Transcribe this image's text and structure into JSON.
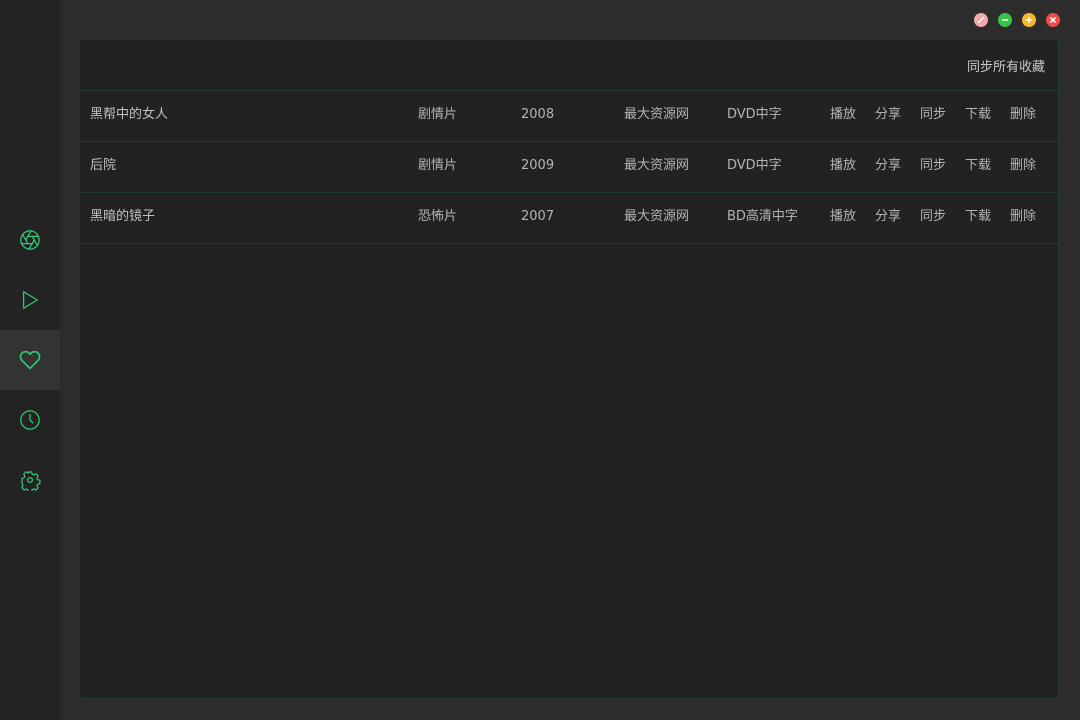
{
  "colors": {
    "accent": "#2ecc71",
    "window_reset": "#f4a7a7",
    "window_minimize": "#39c24a",
    "window_maximize": "#f5b731",
    "window_close": "#ef4b4b"
  },
  "sidebar": {
    "items": [
      {
        "icon": "aperture-icon",
        "active": false
      },
      {
        "icon": "play-icon",
        "active": false
      },
      {
        "icon": "heart-icon",
        "active": true
      },
      {
        "icon": "clock-icon",
        "active": false
      },
      {
        "icon": "gear-icon",
        "active": false
      }
    ]
  },
  "window_controls": [
    "reset-button",
    "minimize-button",
    "maximize-button",
    "close-button"
  ],
  "favorites": {
    "sync_all_label": "同步所有收藏",
    "actions": {
      "play": "播放",
      "share": "分享",
      "sync": "同步",
      "download": "下载",
      "delete": "删除"
    },
    "rows": [
      {
        "title": "黑帮中的女人",
        "genre": "剧情片",
        "year": "2008",
        "source": "最大资源网",
        "quality": "DVD中字"
      },
      {
        "title": "后院",
        "genre": "剧情片",
        "year": "2009",
        "source": "最大资源网",
        "quality": "DVD中字"
      },
      {
        "title": "黑暗的镜子",
        "genre": "恐怖片",
        "year": "2007",
        "source": "最大资源网",
        "quality": "BD高清中字"
      }
    ]
  }
}
